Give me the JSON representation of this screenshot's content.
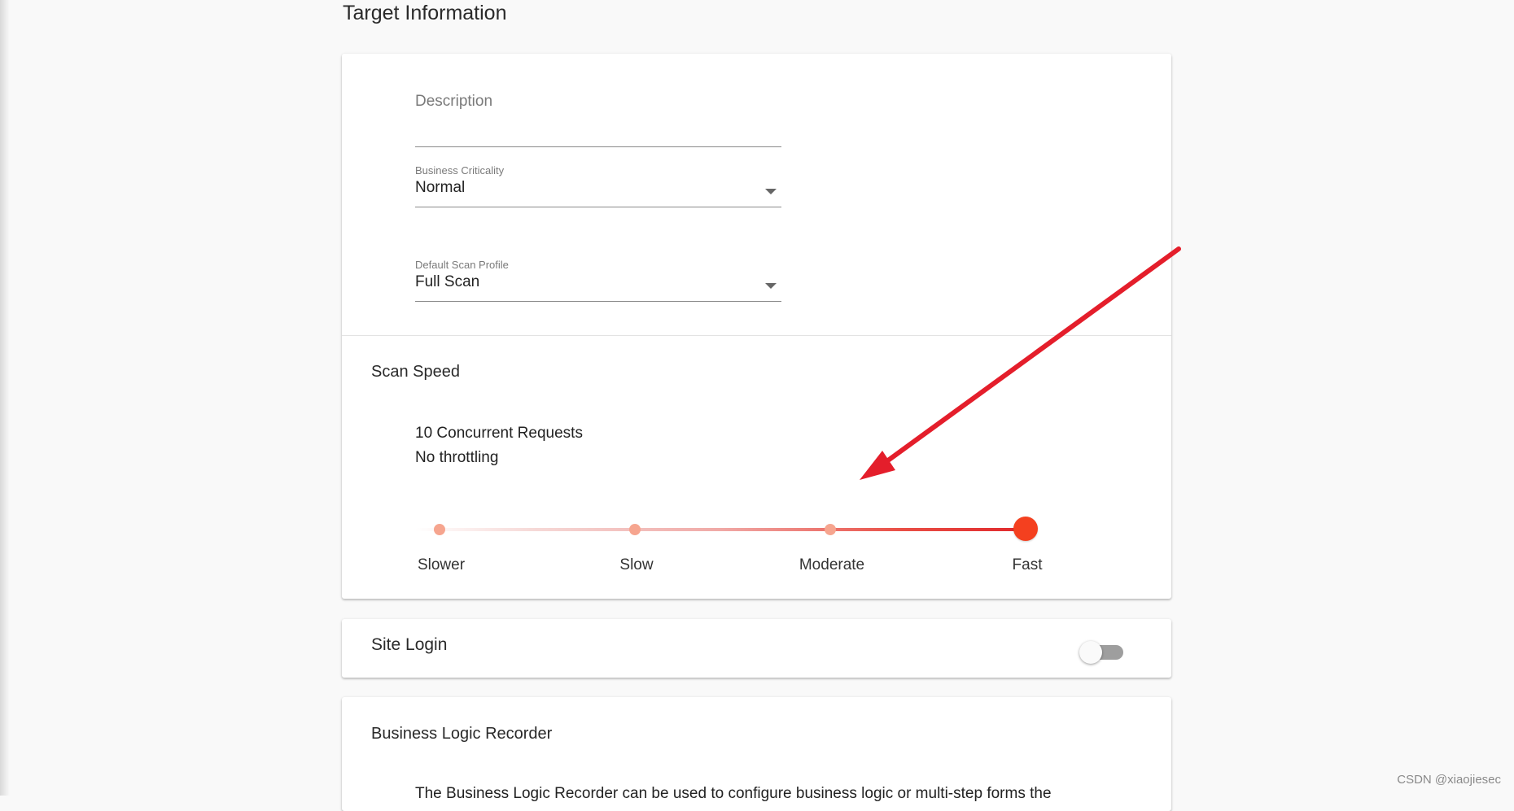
{
  "section": {
    "title": "Target Information"
  },
  "form": {
    "description": {
      "placeholder": "Description",
      "value": ""
    },
    "business_criticality": {
      "label": "Business Criticality",
      "value": "Normal"
    },
    "default_scan_profile": {
      "label": "Default Scan Profile",
      "value": "Full Scan"
    }
  },
  "scan_speed": {
    "title": "Scan Speed",
    "info_line1": "10 Concurrent Requests",
    "info_line2": "No throttling",
    "options": [
      "Slower",
      "Slow",
      "Moderate",
      "Fast"
    ],
    "selected": "Fast",
    "colors": {
      "thumb": "#f4401f",
      "track_end": "#e0282c",
      "dot": "#f6a58f"
    }
  },
  "site_login": {
    "title": "Site Login",
    "enabled": false
  },
  "business_logic_recorder": {
    "title": "Business Logic Recorder",
    "description_partial": "The Business Logic Recorder can be used to configure business logic or multi-step forms the"
  },
  "annotation": {
    "arrow_color": "#e41e2b"
  },
  "watermark": "CSDN @xiaojiesec"
}
